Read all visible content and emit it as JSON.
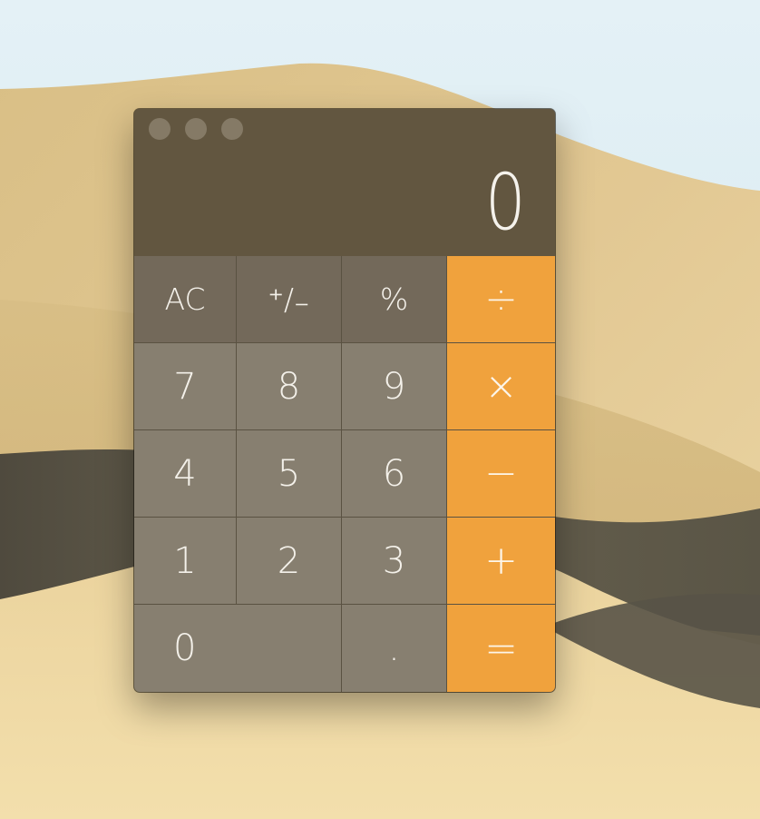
{
  "window": {
    "traffic_lights": [
      "close",
      "minimize",
      "zoom"
    ]
  },
  "display": {
    "value": "0"
  },
  "keys": {
    "row1": [
      "AC",
      "⁺∕₋",
      "%",
      "÷"
    ],
    "row2": [
      "7",
      "8",
      "9",
      "×"
    ],
    "row3": [
      "4",
      "5",
      "6",
      "−"
    ],
    "row4": [
      "1",
      "2",
      "3",
      "+"
    ],
    "row5": [
      "0",
      ".",
      "="
    ]
  },
  "colors": {
    "operator": "#f0a23d",
    "function_key": "#73695a",
    "number_key": "#877f70",
    "display_bg": "#625640"
  }
}
